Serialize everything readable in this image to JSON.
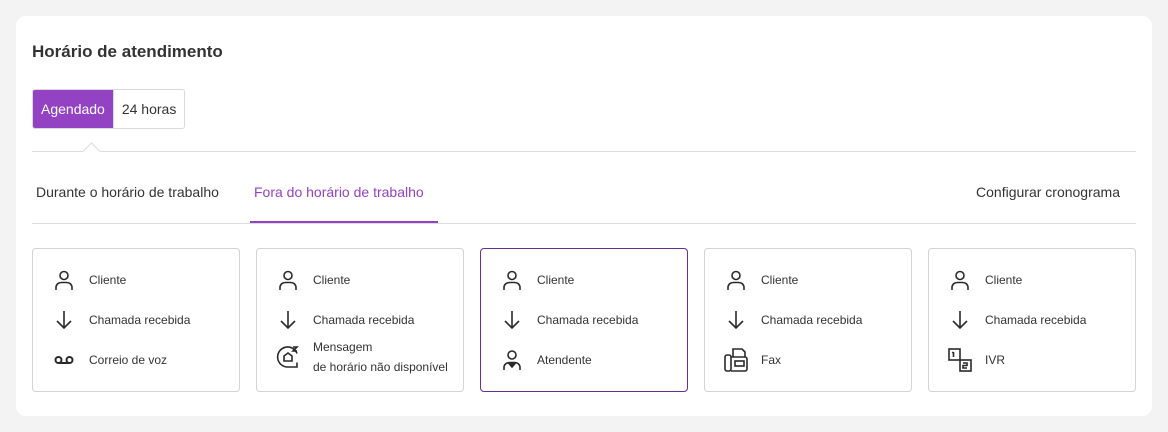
{
  "title": "Horário de atendimento",
  "mode_toggle": {
    "options": [
      "Agendado",
      "24 horas"
    ],
    "selected": "Agendado"
  },
  "tabs": {
    "items": [
      "Durante o horário de trabalho",
      "Fora do horário de trabalho"
    ],
    "active": "Fora do horário de trabalho",
    "configure_label": "Configurar cronograma"
  },
  "accent_color": "#9442c4",
  "cards": [
    {
      "customer": {
        "label": "Cliente",
        "icon": "person-icon"
      },
      "call": {
        "label": "Chamada recebida",
        "icon": "arrow-down-icon"
      },
      "destination": {
        "label": "Correio de voz",
        "icon": "voicemail-icon"
      },
      "selected": false
    },
    {
      "customer": {
        "label": "Cliente",
        "icon": "person-icon"
      },
      "call": {
        "label": "Chamada recebida",
        "icon": "arrow-down-icon"
      },
      "destination": {
        "label_line1": "Mensagem",
        "label_line2": "de horário não disponível",
        "icon": "message-sleep-icon"
      },
      "selected": false
    },
    {
      "customer": {
        "label": "Cliente",
        "icon": "person-icon"
      },
      "call": {
        "label": "Chamada recebida",
        "icon": "arrow-down-icon"
      },
      "destination": {
        "label": "Atendente",
        "icon": "agent-icon"
      },
      "selected": true
    },
    {
      "customer": {
        "label": "Cliente",
        "icon": "person-icon"
      },
      "call": {
        "label": "Chamada recebida",
        "icon": "arrow-down-icon"
      },
      "destination": {
        "label": "Fax",
        "icon": "fax-icon"
      },
      "selected": false
    },
    {
      "customer": {
        "label": "Cliente",
        "icon": "person-icon"
      },
      "call": {
        "label": "Chamada recebida",
        "icon": "arrow-down-icon"
      },
      "destination": {
        "label": "IVR",
        "icon": "ivr-icon"
      },
      "selected": false
    }
  ]
}
